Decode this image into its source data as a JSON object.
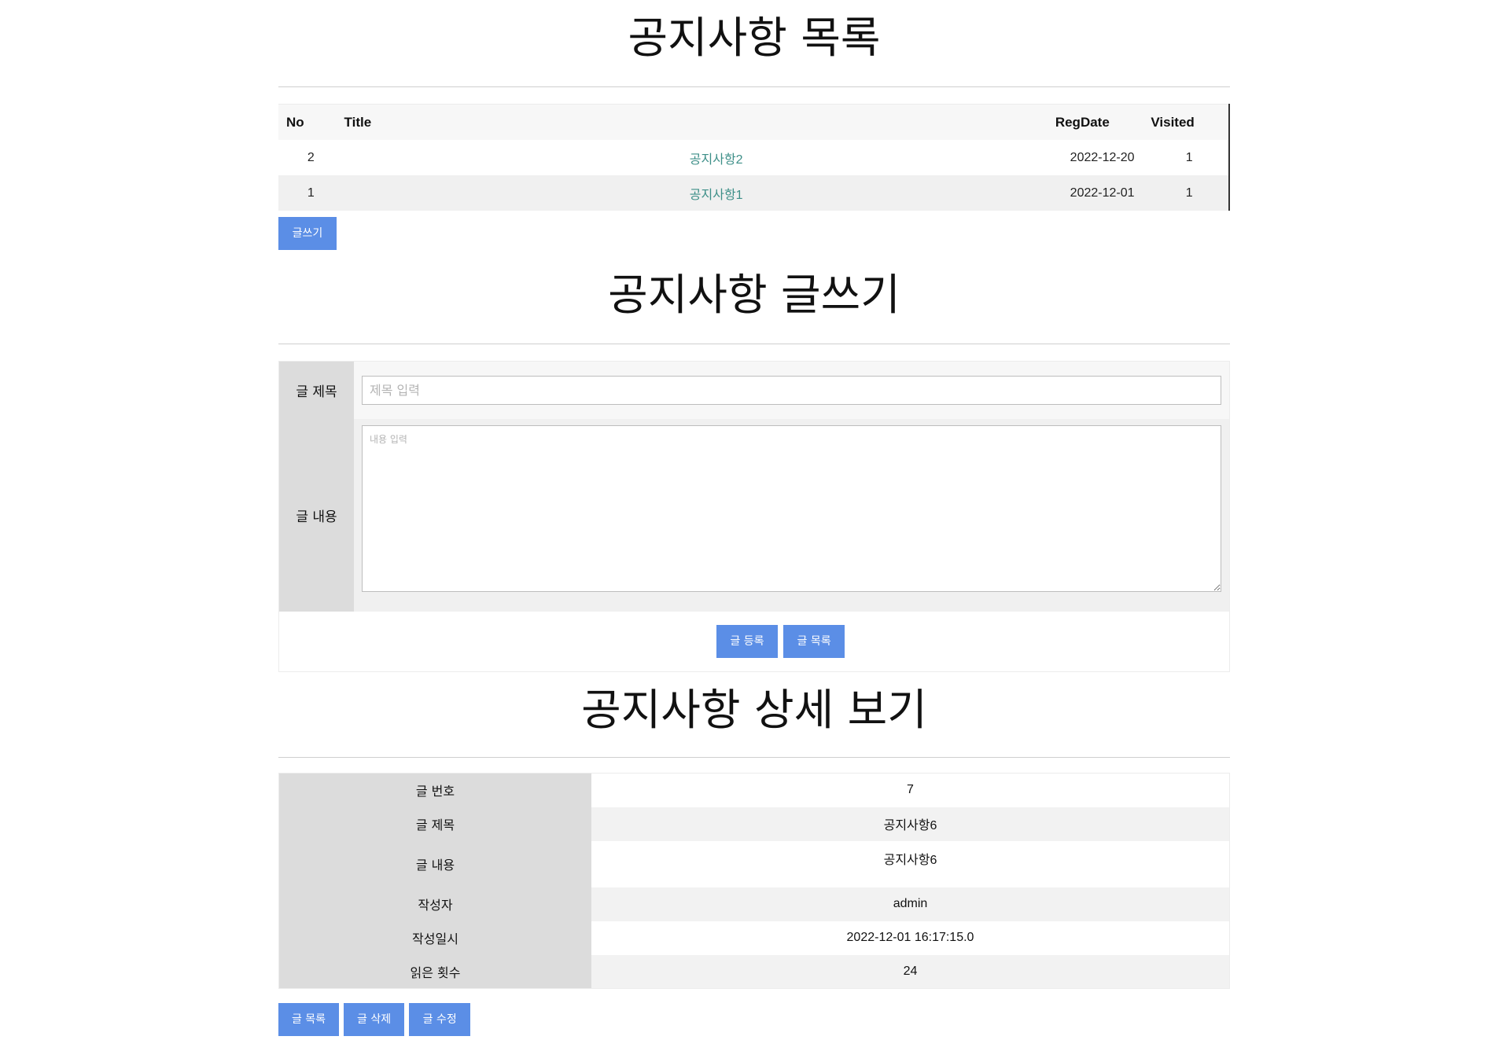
{
  "list": {
    "title": "공지사항 목록",
    "columns": [
      "No",
      "Title",
      "RegDate",
      "Visited"
    ],
    "rows": [
      {
        "no": "2",
        "title": "공지사항2",
        "regdate": "2022-12-20",
        "visited": "1"
      },
      {
        "no": "1",
        "title": "공지사항1",
        "regdate": "2022-12-01",
        "visited": "1"
      }
    ],
    "write_button": "글쓰기"
  },
  "write": {
    "title": "공지사항 글쓰기",
    "title_label": "글 제목",
    "title_placeholder": "제목 입력",
    "content_label": "글 내용",
    "content_placeholder": "내용 입력",
    "submit_button": "글 등록",
    "list_button": "글 목록"
  },
  "detail": {
    "title": "공지사항 상세 보기",
    "fields": [
      {
        "label": "글 번호",
        "value": "7"
      },
      {
        "label": "글 제목",
        "value": "공지사항6"
      },
      {
        "label": "글 내용",
        "value": "공지사항6"
      },
      {
        "label": "작성자",
        "value": "admin"
      },
      {
        "label": "작성일시",
        "value": "2022-12-01 16:17:15.0"
      },
      {
        "label": "읽은 횟수",
        "value": "24"
      }
    ],
    "buttons": {
      "list": "글 목록",
      "delete": "글 삭제",
      "edit": "글 수정"
    }
  },
  "colors": {
    "button": "#5b8ee6",
    "link": "#3d8f88",
    "label_bg": "#dcdcdc"
  }
}
